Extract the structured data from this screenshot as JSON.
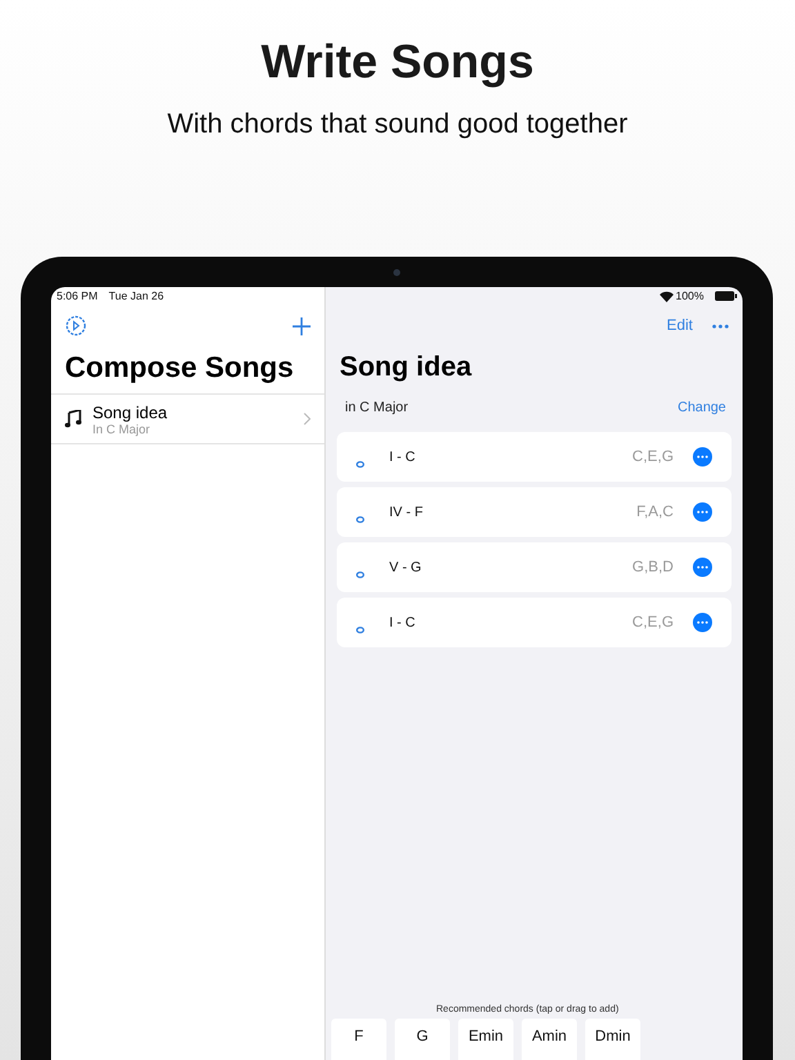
{
  "headline": "Write Songs",
  "subtitle": "With chords that sound good together",
  "status_bar": {
    "time": "5:06 PM",
    "date": "Tue Jan 26",
    "battery": "100%"
  },
  "sidebar": {
    "title": "Compose Songs",
    "items": [
      {
        "title": "Song idea",
        "subtitle": "In C Major",
        "selected": false
      }
    ]
  },
  "detail": {
    "title": "Song idea",
    "actions": [
      "Edit"
    ],
    "key": "in C Major",
    "change": "Change",
    "chords": [
      {
        "name": "I - C",
        "notes": "C,E,G"
      },
      {
        "name": "IV - F",
        "notes": "F,A,C"
      },
      {
        "name": "V - G",
        "notes": "G,B,D"
      },
      {
        "name": "I - C",
        "notes": "C,E,G"
      }
    ],
    "recommended_label": "Recommended chords (tap or drag to add)",
    "recommended": [
      "F",
      "G",
      "Emin",
      "Amin",
      "Dmin"
    ]
  }
}
